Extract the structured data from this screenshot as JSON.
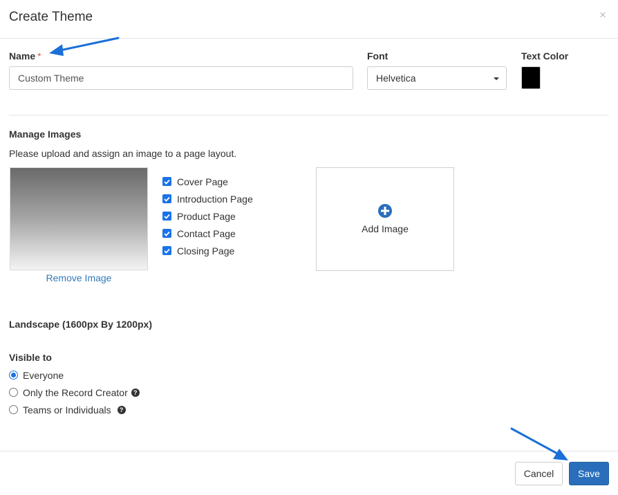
{
  "dialog": {
    "title": "Create Theme",
    "close_glyph": "×"
  },
  "fields": {
    "name_label": "Name",
    "required_mark": "*",
    "name_value": "Custom Theme",
    "font_label": "Font",
    "font_value": "Helvetica",
    "text_color_label": "Text Color",
    "text_color": "#000000"
  },
  "images": {
    "heading": "Manage Images",
    "instructions": "Please upload and assign an image to a page layout.",
    "remove_label": "Remove Image",
    "pages": [
      {
        "label": "Cover Page",
        "checked": true
      },
      {
        "label": "Introduction Page",
        "checked": true
      },
      {
        "label": "Product Page",
        "checked": true
      },
      {
        "label": "Contact Page",
        "checked": true
      },
      {
        "label": "Closing Page",
        "checked": true
      }
    ],
    "add_label": "Add Image"
  },
  "landscape_label": "Landscape (1600px By 1200px)",
  "visibility": {
    "label": "Visible to",
    "options": [
      {
        "label": "Everyone",
        "selected": true
      },
      {
        "label": "Only the Record Creator",
        "selected": false
      },
      {
        "label": "Teams or Individuals",
        "selected": false
      }
    ]
  },
  "footer": {
    "cancel_label": "Cancel",
    "save_label": "Save"
  },
  "icons": {
    "help": "?",
    "annotation_arrows": [
      "arrow-to-name-label",
      "arrow-to-save-button"
    ]
  },
  "colors": {
    "primary": "#2a6ebb",
    "link": "#337ab7",
    "required": "#d9534f",
    "annotation_arrow": "#1a6fd8"
  }
}
